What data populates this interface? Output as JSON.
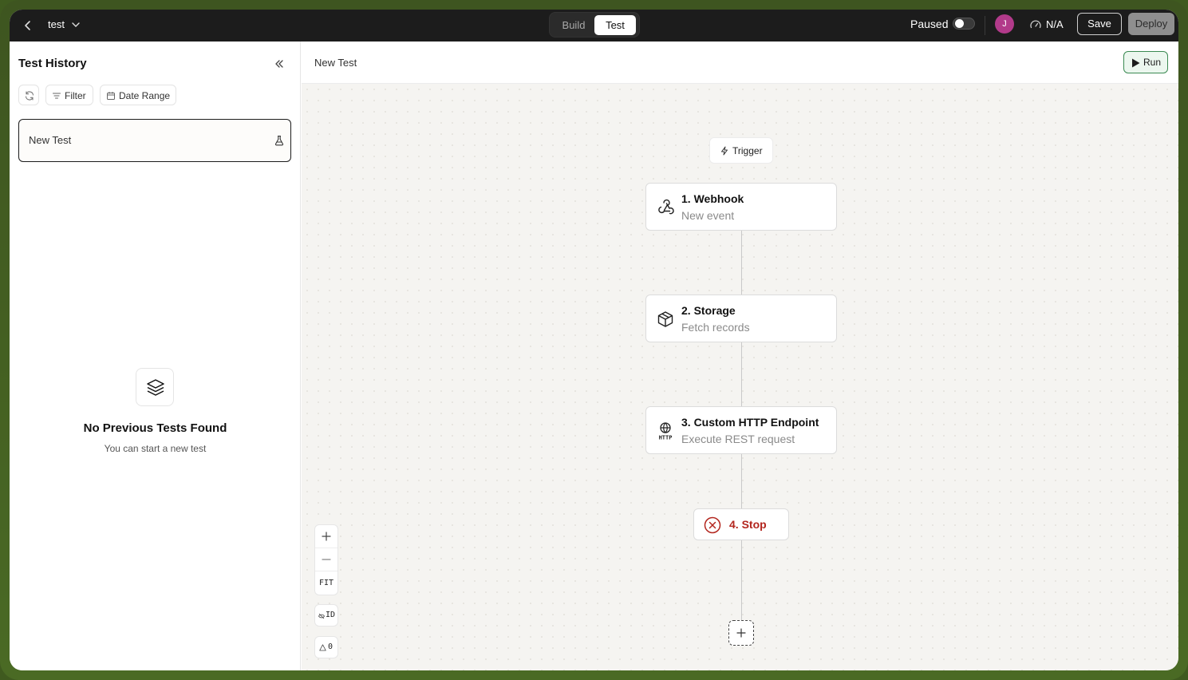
{
  "topbar": {
    "workflow_name": "test",
    "modes": {
      "build": "Build",
      "test": "Test",
      "active": "Test"
    },
    "paused_label": "Paused",
    "paused_on": false,
    "avatar_initial": "J",
    "avatar_color": "#b23a8a",
    "status_value": "N/A",
    "save_label": "Save",
    "deploy_label": "Deploy"
  },
  "sidebar": {
    "title": "Test History",
    "filter_label": "Filter",
    "date_range_label": "Date Range",
    "current_test": "New Test",
    "empty_title": "No Previous Tests Found",
    "empty_subtitle": "You can start a new test"
  },
  "main": {
    "title": "New Test",
    "run_label": "Run",
    "run_accent": "#3b8a52"
  },
  "flow": {
    "trigger_label": "Trigger",
    "nodes": [
      {
        "title": "1. Webhook",
        "subtitle": "New event",
        "icon": "webhook-icon"
      },
      {
        "title": "2. Storage",
        "subtitle": "Fetch records",
        "icon": "box-icon"
      },
      {
        "title": "3. Custom HTTP Endpoint",
        "subtitle": "Execute REST request",
        "icon": "http-globe-icon"
      }
    ],
    "stop": {
      "title": "4. Stop",
      "icon": "x-circle-icon",
      "color": "#b3261e"
    }
  },
  "controls": {
    "fit_label": "FIT",
    "id_label": "ID",
    "warning_count": "0"
  }
}
